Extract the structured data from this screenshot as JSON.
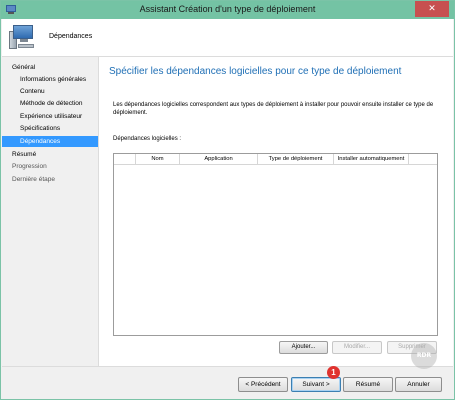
{
  "window": {
    "title": "Assistant Création d'un type de déploiement",
    "close_glyph": "✕"
  },
  "header": {
    "title": "Dépendances",
    "icon": "computer-icon"
  },
  "nav": {
    "items": [
      {
        "label": "Général",
        "level": 0,
        "selected": false,
        "muted": false
      },
      {
        "label": "Informations générales",
        "level": 1,
        "selected": false,
        "muted": false
      },
      {
        "label": "Contenu",
        "level": 1,
        "selected": false,
        "muted": false
      },
      {
        "label": "Méthode de détection",
        "level": 1,
        "selected": false,
        "muted": false
      },
      {
        "label": "Expérience utilisateur",
        "level": 1,
        "selected": false,
        "muted": false
      },
      {
        "label": "Spécifications",
        "level": 1,
        "selected": false,
        "muted": false
      },
      {
        "label": "Dépendances",
        "level": 1,
        "selected": true,
        "muted": false
      },
      {
        "label": "Résumé",
        "level": 0,
        "selected": false,
        "muted": false
      },
      {
        "label": "Progression",
        "level": 0,
        "selected": false,
        "muted": true
      },
      {
        "label": "Dernière étape",
        "level": 0,
        "selected": false,
        "muted": true
      }
    ]
  },
  "main": {
    "page_title": "Spécifier les dépendances logicielles pour ce type de déploiement",
    "description": "Les dépendances logicielles correspondent aux types de déploiement à installer pour pouvoir ensuite installer ce type de déploiement.",
    "deps_label": "Dépendances logicielles :",
    "table": {
      "columns": [
        "",
        "Nom",
        "Application",
        "Type de déploiement",
        "Installer automatiquement"
      ],
      "rows": []
    },
    "buttons": {
      "add": "Ajouter...",
      "edit": "Modifier...",
      "delete": "Supprimer"
    }
  },
  "footer": {
    "prev": "< Précédent",
    "next": "Suivant >",
    "summary": "Résumé",
    "cancel": "Annuler",
    "badge": "1"
  },
  "watermark": "RDR",
  "colors": {
    "titlebar": "#74c3a4",
    "close": "#c75050",
    "selection": "#3399ff",
    "heading": "#1f6fb5",
    "badge": "#e0332f"
  }
}
